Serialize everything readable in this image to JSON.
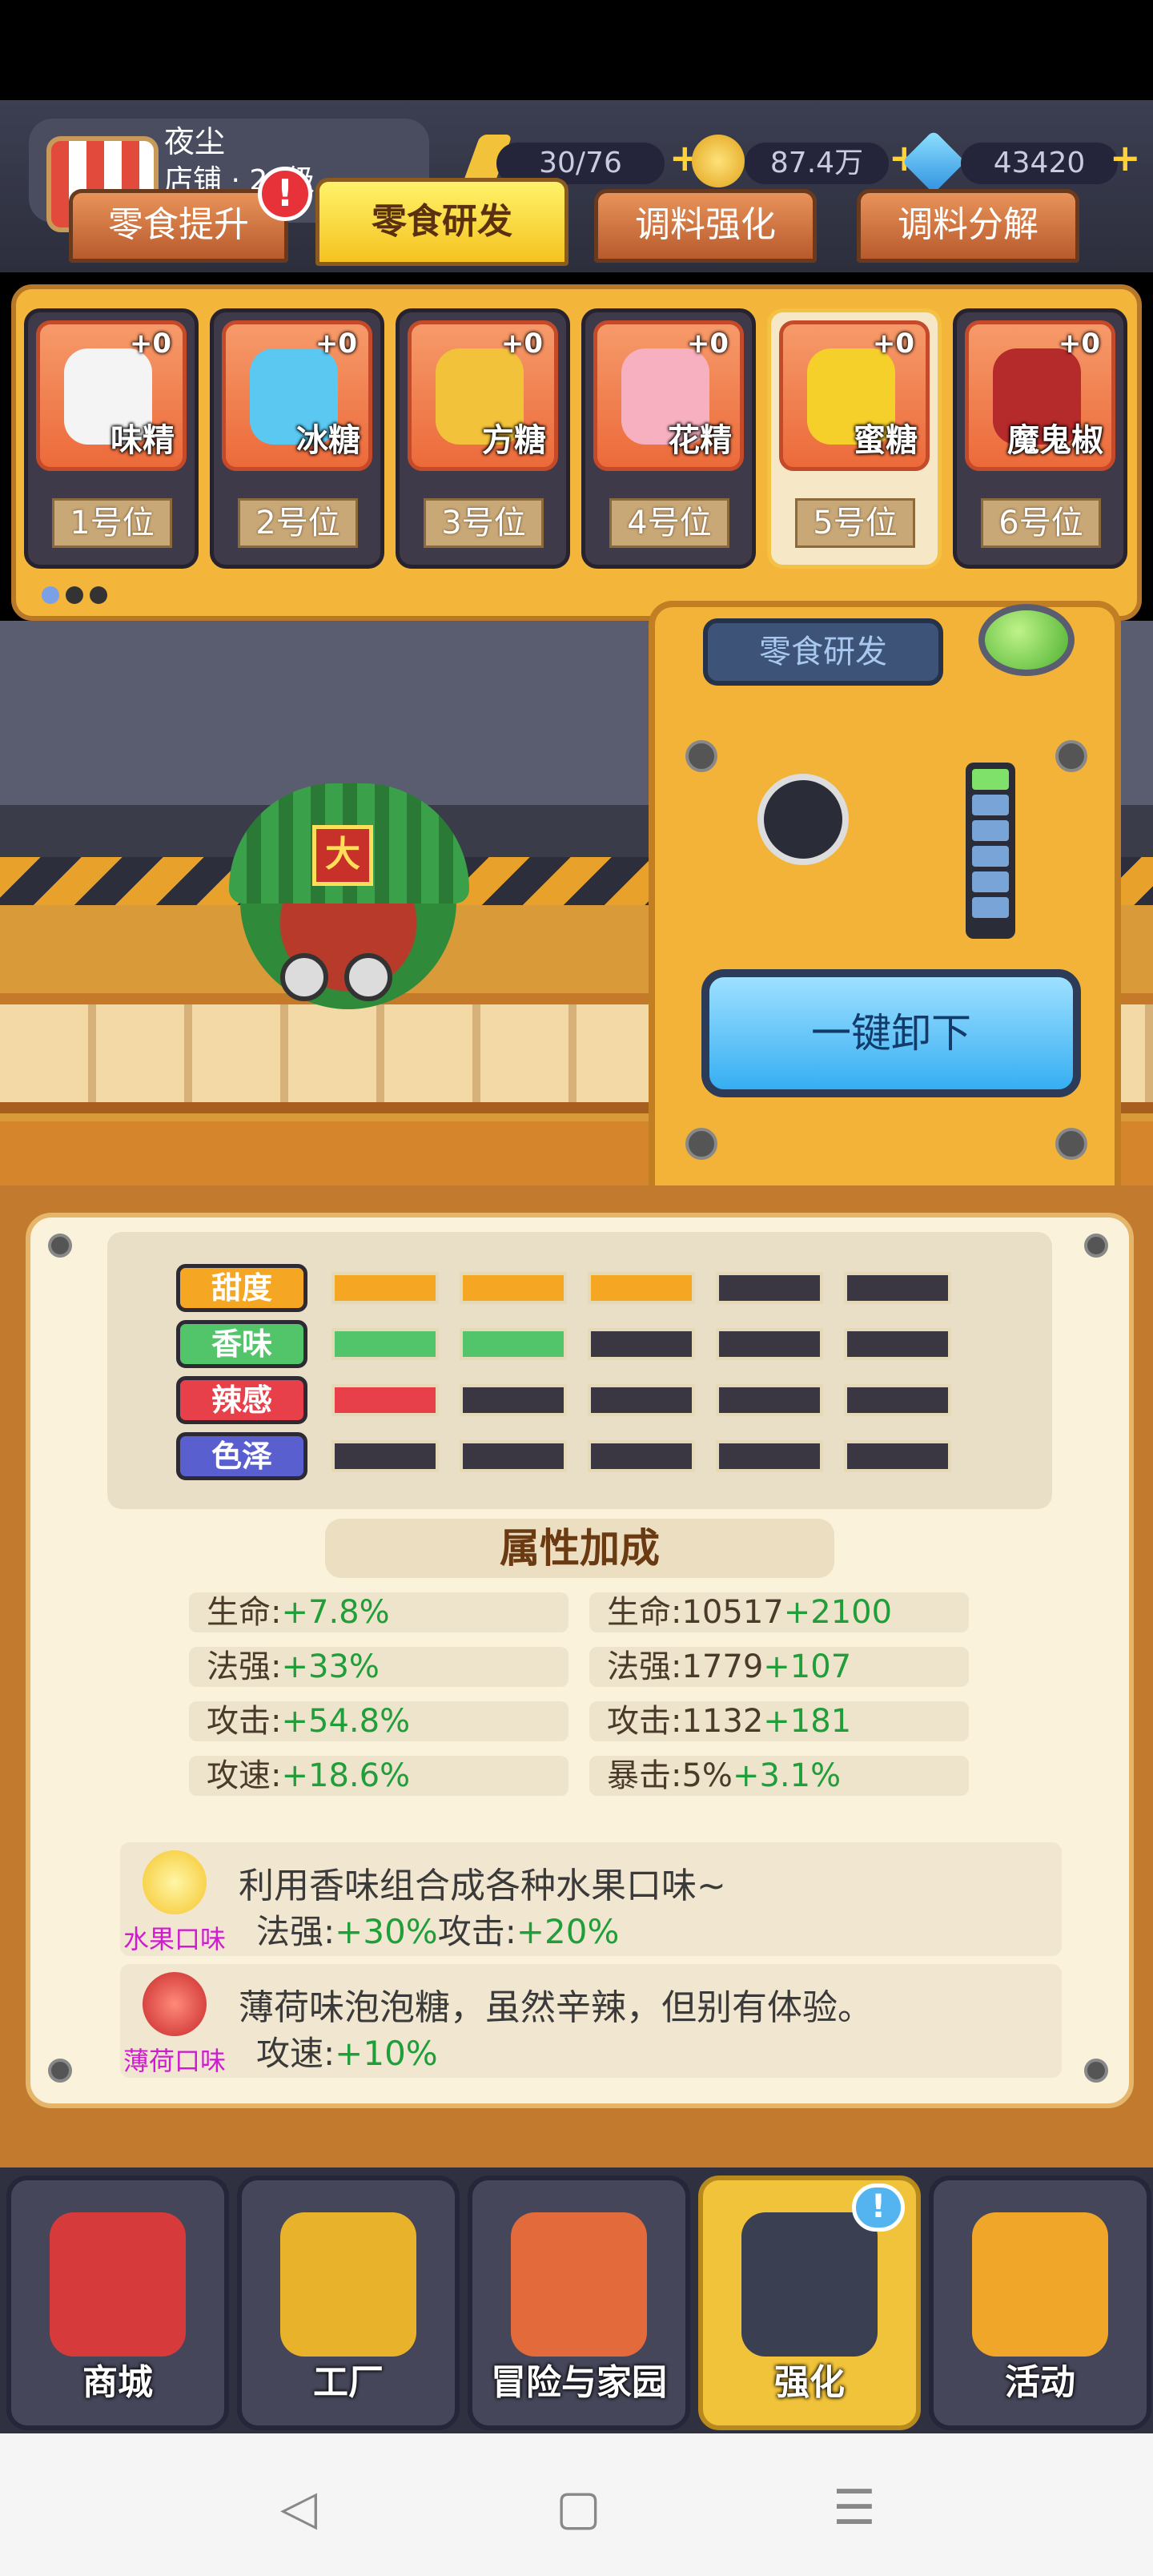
{
  "header": {
    "shop_name": "夜尘",
    "shop_level": "店铺 · 20级",
    "energy": "30/76",
    "gold": "87.4万",
    "gems": "43420",
    "plus": "+"
  },
  "tabs": [
    {
      "label": "零食提升"
    },
    {
      "label": "零食研发"
    },
    {
      "label": "调料强化"
    },
    {
      "label": "调料分解"
    }
  ],
  "tab_badge": "!",
  "slots": [
    {
      "name": "味精",
      "level": "+0",
      "position": "1号位",
      "color": "#f4f4f4"
    },
    {
      "name": "冰糖",
      "level": "+0",
      "position": "2号位",
      "color": "#5ac8f0"
    },
    {
      "name": "方糖",
      "level": "+0",
      "position": "3号位",
      "color": "#f2c23a"
    },
    {
      "name": "花精",
      "level": "+0",
      "position": "4号位",
      "color": "#f7b0c0"
    },
    {
      "name": "蜜糖",
      "level": "+0",
      "position": "5号位",
      "color": "#f5cf2a"
    },
    {
      "name": "魔鬼椒",
      "level": "+0",
      "position": "6号位",
      "color": "#b52a2a"
    }
  ],
  "mascot_tag": "大",
  "machine": {
    "label": "零食研发",
    "unload_button": "一键卸下",
    "level_lit": 1,
    "level_total": 6
  },
  "stats": [
    {
      "label": "甜度",
      "filled": 3,
      "total": 5,
      "color": "#f5a623"
    },
    {
      "label": "香味",
      "filled": 2,
      "total": 5,
      "color": "#52c46a"
    },
    {
      "label": "辣感",
      "filled": 1,
      "total": 5,
      "color": "#e8404a"
    },
    {
      "label": "色泽",
      "filled": 0,
      "total": 5,
      "color": "#5a5fd0"
    }
  ],
  "attr_title": "属性加成",
  "attrs_left": [
    {
      "name": "生命:",
      "value": "+7.8%"
    },
    {
      "name": "法强:",
      "value": "+33%"
    },
    {
      "name": "攻击:",
      "value": "+54.8%"
    },
    {
      "name": "攻速:",
      "value": "+18.6%"
    }
  ],
  "attrs_right": [
    {
      "name": "生命:10517",
      "value": "+2100"
    },
    {
      "name": "法强:1779",
      "value": "+107"
    },
    {
      "name": "攻击:1132",
      "value": "+181"
    },
    {
      "name": "暴击:5%",
      "value": "+3.1%"
    }
  ],
  "flavors": [
    {
      "name": "水果口味",
      "desc": "利用香味组合成各种水果口味~",
      "bonus1_label": "法强:",
      "bonus1_value": "+30%",
      "bonus2_label": "攻击:",
      "bonus2_value": "+20%"
    },
    {
      "name": "薄荷口味",
      "desc": "薄荷味泡泡糖，虽然辛辣，但别有体验。",
      "bonus1_label": "攻速:",
      "bonus1_value": "+10%"
    }
  ],
  "nav": [
    {
      "label": "商城"
    },
    {
      "label": "工厂"
    },
    {
      "label": "冒险与家园"
    },
    {
      "label": "强化"
    },
    {
      "label": "活动"
    }
  ],
  "nav_badge": "!",
  "system_nav": {
    "back": "◁",
    "home": "▢",
    "menu": "☰"
  }
}
